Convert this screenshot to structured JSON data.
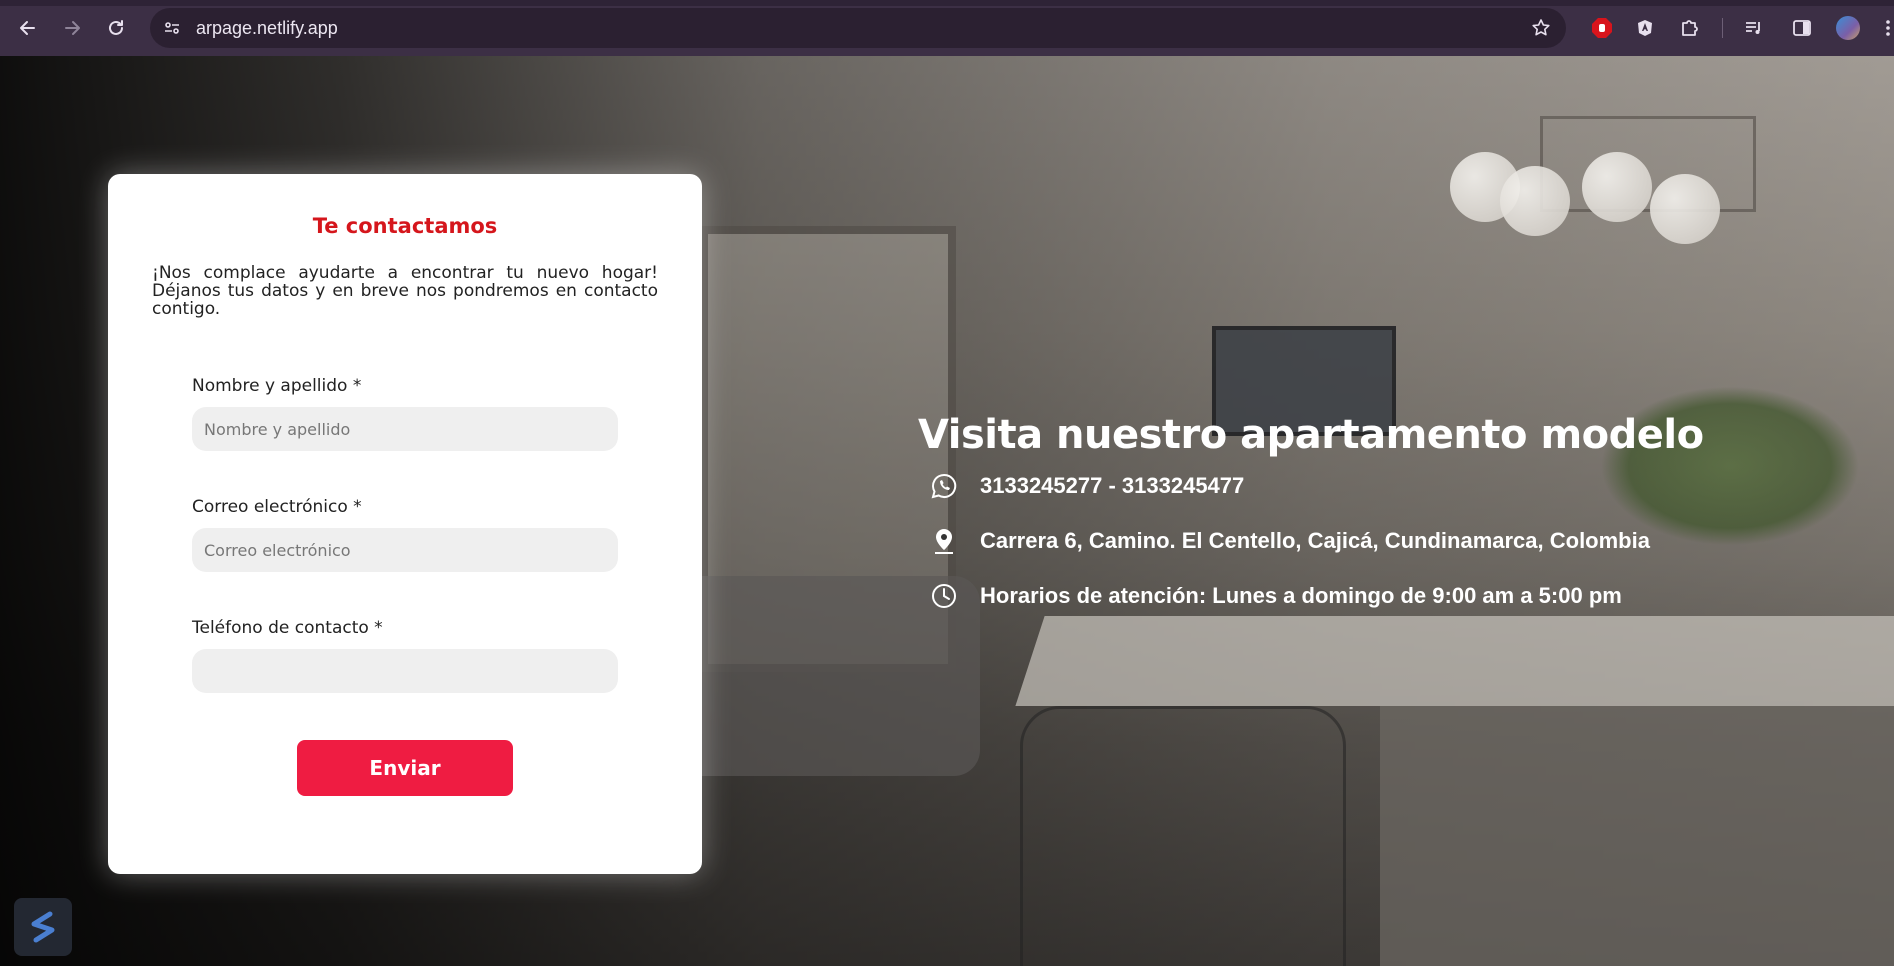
{
  "browser": {
    "url": "arpage.netlify.app"
  },
  "info": {
    "title": "Visita nuestro apartamento modelo",
    "phones": "3133245277 - 3133245477",
    "address": "Carrera 6, Camino. El Centello, Cajicá, Cundinamarca, Colombia",
    "hours": "Horarios de atención: Lunes a domingo de 9:00 am a 5:00 pm"
  },
  "form": {
    "title": "Te contactamos",
    "intro": "¡Nos complace ayudarte a encontrar tu nuevo hogar! Déjanos tus datos y en breve nos pondremos en contacto contigo.",
    "name_label": "Nombre y apellido *",
    "name_placeholder": "Nombre y apellido",
    "email_label": "Correo electrónico *",
    "email_placeholder": "Correo electrónico",
    "phone_label": "Teléfono de contacto *",
    "phone_placeholder": "",
    "submit_label": "Enviar"
  },
  "colors": {
    "accent_red": "#d5161c",
    "button_red": "#ef1c42",
    "chrome_bg": "#3c2f45"
  }
}
